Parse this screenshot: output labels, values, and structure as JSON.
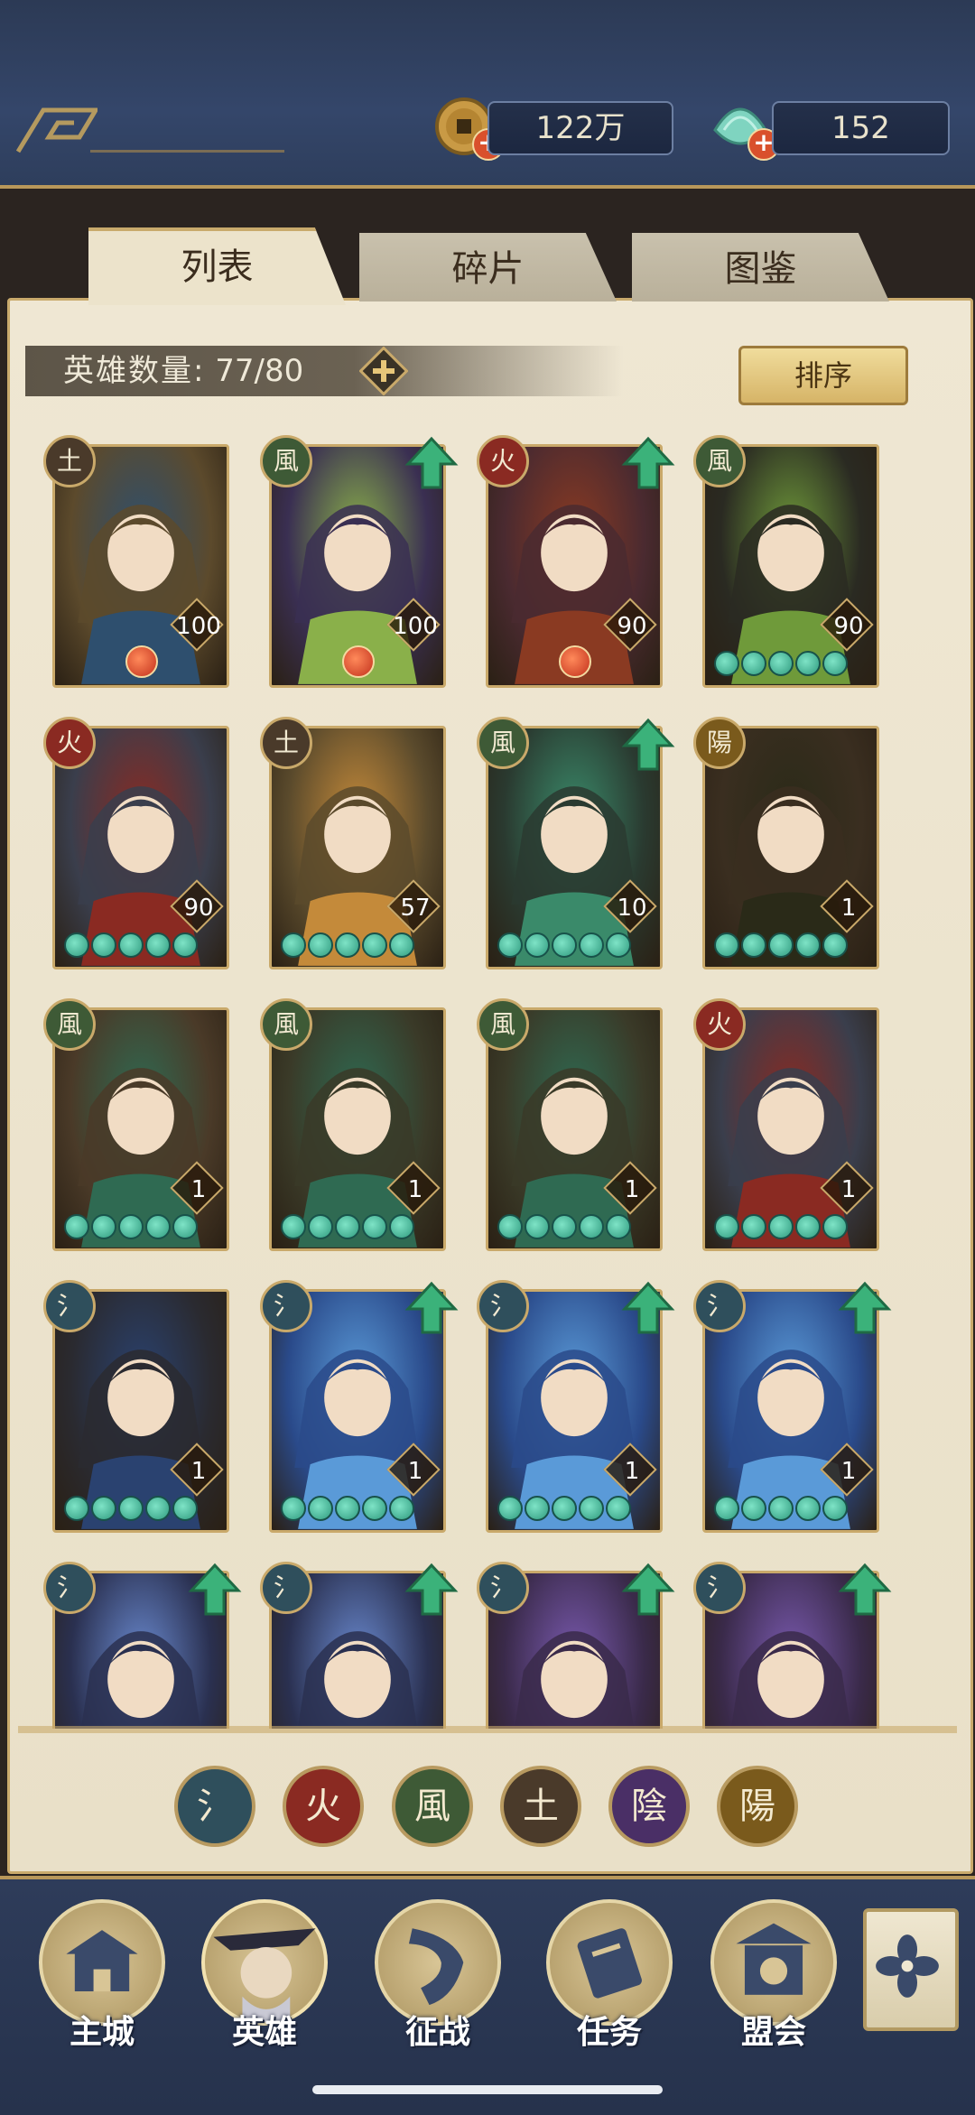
{
  "resources": {
    "coins": "122万",
    "jade": "152",
    "coin_icon": "copper-coin-icon",
    "jade_icon": "jade-shell-icon"
  },
  "tabs": [
    {
      "label": "列表",
      "active": true
    },
    {
      "label": "碎片",
      "active": false
    },
    {
      "label": "图鉴",
      "active": false
    }
  ],
  "hero_count": {
    "label": "英雄数量:",
    "value": "77/80"
  },
  "sort_label": "排序",
  "element_glyphs": {
    "water": "氵",
    "fire": "火",
    "wind": "風",
    "earth": "土",
    "yin": "陰",
    "yang": "陽"
  },
  "element_colors": {
    "water": "#2f4f5c",
    "fire": "#8a2a22",
    "wind": "#3e5a36",
    "earth": "#4a3a2a",
    "yin": "#4a2f66",
    "yang": "#7a5a1c"
  },
  "heroes": [
    {
      "element": "earth",
      "level": "100",
      "stars": 0,
      "upgrade": false,
      "palette": [
        "#5c4a2c",
        "#2e4f6e"
      ]
    },
    {
      "element": "wind",
      "level": "100",
      "stars": 0,
      "upgrade": true,
      "palette": [
        "#3a2f52",
        "#8ab04a"
      ]
    },
    {
      "element": "fire",
      "level": "90",
      "stars": 0,
      "upgrade": true,
      "palette": [
        "#4a2a30",
        "#8a3a22"
      ]
    },
    {
      "element": "wind",
      "level": "90",
      "stars": 5,
      "upgrade": false,
      "palette": [
        "#2a2a22",
        "#6f9a3a"
      ]
    },
    {
      "element": "fire",
      "level": "90",
      "stars": 5,
      "upgrade": false,
      "palette": [
        "#3a3e4c",
        "#8a2a22"
      ]
    },
    {
      "element": "earth",
      "level": "57",
      "stars": 5,
      "upgrade": false,
      "palette": [
        "#5a4a2c",
        "#c48a3a"
      ]
    },
    {
      "element": "wind",
      "level": "10",
      "stars": 5,
      "upgrade": true,
      "palette": [
        "#2a3a30",
        "#3a8a6a"
      ]
    },
    {
      "element": "yang",
      "level": "1",
      "stars": 5,
      "upgrade": false,
      "palette": [
        "#3a2e20",
        "#2a2a18"
      ]
    },
    {
      "element": "wind",
      "level": "1",
      "stars": 5,
      "upgrade": false,
      "palette": [
        "#4a3a28",
        "#2f6a52"
      ]
    },
    {
      "element": "wind",
      "level": "1",
      "stars": 5,
      "upgrade": false,
      "palette": [
        "#3a3a28",
        "#2f6a52"
      ]
    },
    {
      "element": "wind",
      "level": "1",
      "stars": 5,
      "upgrade": false,
      "palette": [
        "#3a3a28",
        "#2f6a52"
      ]
    },
    {
      "element": "fire",
      "level": "1",
      "stars": 5,
      "upgrade": false,
      "palette": [
        "#3a3e4c",
        "#8a2a22"
      ]
    },
    {
      "element": "water",
      "level": "1",
      "stars": 5,
      "upgrade": false,
      "palette": [
        "#2a2a30",
        "#2a4270"
      ]
    },
    {
      "element": "water",
      "level": "1",
      "stars": 5,
      "upgrade": true,
      "palette": [
        "#2a4a8a",
        "#5a9ad8"
      ]
    },
    {
      "element": "water",
      "level": "1",
      "stars": 5,
      "upgrade": true,
      "palette": [
        "#2a4a8a",
        "#5a9ad8"
      ]
    },
    {
      "element": "water",
      "level": "1",
      "stars": 5,
      "upgrade": true,
      "palette": [
        "#2a4a8a",
        "#5a9ad8"
      ]
    },
    {
      "element": "water",
      "level": "",
      "stars": 0,
      "upgrade": true,
      "palette": [
        "#2a3050",
        "#6a8ad0"
      ]
    },
    {
      "element": "water",
      "level": "",
      "stars": 0,
      "upgrade": true,
      "palette": [
        "#2a3050",
        "#6a8ad0"
      ]
    },
    {
      "element": "water",
      "level": "",
      "stars": 0,
      "upgrade": true,
      "palette": [
        "#3a2a4a",
        "#7a5ab0"
      ]
    },
    {
      "element": "water",
      "level": "",
      "stars": 0,
      "upgrade": true,
      "palette": [
        "#3a2a4a",
        "#7a5ab0"
      ]
    }
  ],
  "filters": [
    "water",
    "fire",
    "wind",
    "earth",
    "yin",
    "yang"
  ],
  "nav": [
    {
      "label": "主城",
      "icon": "city-gate-icon"
    },
    {
      "label": "英雄",
      "icon": "hero-portrait-icon",
      "active": true
    },
    {
      "label": "征战",
      "icon": "war-horn-icon"
    },
    {
      "label": "任务",
      "icon": "scroll-task-icon"
    },
    {
      "label": "盟会",
      "icon": "alliance-gate-icon"
    }
  ],
  "side_icon": "menu-flower-icon"
}
